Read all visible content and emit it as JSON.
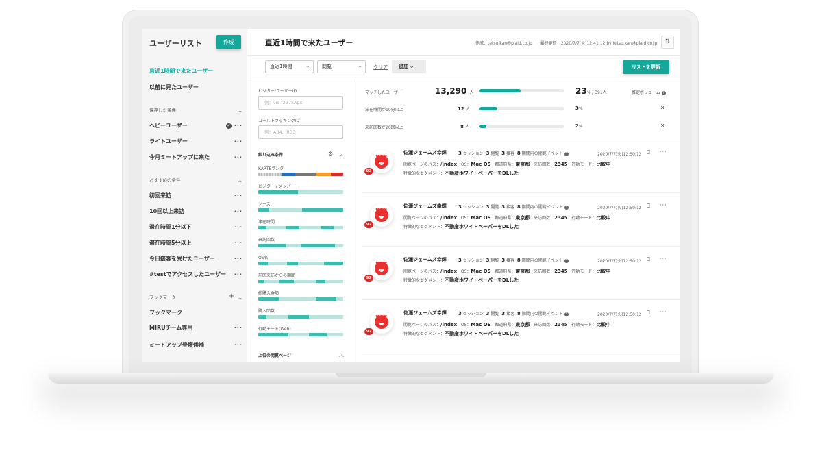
{
  "sidebar": {
    "title": "ユーザーリスト",
    "create_label": "作成",
    "top_items": [
      "直近1時間で来たユーザー",
      "以前に見たユーザー"
    ],
    "saved_section": "保存した条件",
    "saved_items": [
      "ヘビーユーザー",
      "ライトユーザー",
      "今月ミートアップに来た"
    ],
    "recommended_section": "おすすめの条件",
    "recommended_items": [
      "初回来訪",
      "10回以上来訪",
      "滞在時間1分以下",
      "滞在時間5分以上",
      "今日接客を受けたユーザー",
      "#testでアクセスしたユーザー"
    ],
    "bookmark_section": "ブックマーク",
    "bookmark_items": [
      "ブックマーク",
      "MIRUチーム専用",
      "ミートアップ登壇候補"
    ]
  },
  "header": {
    "title": "直近1時間で来たユーザー",
    "meta": "作成：tetsu.kan@plaid.co.jp　　最終更新：2020/7/7(火)12:41:12 by tetsu.kan@plaid.co.jp"
  },
  "toolbar": {
    "period": "直近1時間",
    "type": "閲覧",
    "clear": "クリア",
    "add": "追加",
    "update": "リストを更新"
  },
  "filters": {
    "visitor_id_label": "ビジター/ユーザーID",
    "visitor_id_placeholder": "例：vis-f297kApx",
    "call_id_label": "コールトラッキングID",
    "call_id_placeholder": "例：A34、RB3",
    "narrow_label": "絞り込み条件",
    "bars": [
      "KARTEランク",
      "ビジター / メンバー",
      "ソース",
      "滞在時間",
      "来訪回数",
      "OS名",
      "前回来訪からの期間",
      "総購入金額",
      "購入回数",
      "行動モード(Web)"
    ],
    "top_pages": "上位の閲覧ページ"
  },
  "stats": {
    "matched_label": "マッチしたユーザー",
    "matched_value": "13,290",
    "matched_unit": "人",
    "matched_pct": "23",
    "matched_of": "% / 391人",
    "matched_fill": 0.48,
    "estimate": "推定ボリューム",
    "rows": [
      {
        "label": "滞在時間が10分以上",
        "value": "12",
        "unit": "人",
        "pct": "3",
        "pct_unit": "%",
        "fill": 0.21
      },
      {
        "label": "来訪回数が20回以上",
        "value": "8",
        "unit": "人",
        "pct": "2",
        "pct_unit": "%",
        "fill": 0.08
      }
    ]
  },
  "user_cards": [
    {
      "name": "佐瀬ジェームズ幸輝",
      "sessions": "3",
      "sessions_label": "セッション",
      "views": "3",
      "views_label": "閲覧",
      "contacts": "3",
      "contacts_label": "接客",
      "events": "8",
      "events_label": "期間内の閲覧イベント",
      "date": "2020/7/7(火)12:50:12",
      "path_label": "閲覧ページのパス：",
      "path": "/index",
      "os_label": "OS：",
      "os": "Mac OS",
      "pref_label": "都道府県：",
      "pref": "東京都",
      "visits_label": "来訪回数：",
      "visits": "2345",
      "mode_label": "行動モード：",
      "mode": "比較中",
      "segment_label": "特徴的なセグメント：",
      "segment": "不動産ホワイトペーパーをDLした",
      "score": "92"
    },
    {
      "name": "佐瀬ジェームズ幸輝",
      "sessions": "3",
      "sessions_label": "セッション",
      "views": "3",
      "views_label": "閲覧",
      "contacts": "3",
      "contacts_label": "接客",
      "events": "8",
      "events_label": "期間内の閲覧イベント",
      "date": "2020/7/7(火)12:50:12",
      "path_label": "閲覧ページのパス：",
      "path": "/index",
      "os_label": "OS：",
      "os": "Mac OS",
      "pref_label": "都道府県：",
      "pref": "東京都",
      "visits_label": "来訪回数：",
      "visits": "2345",
      "mode_label": "行動モード：",
      "mode": "比較中",
      "segment_label": "特徴的なセグメント：",
      "segment": "不動産ホワイトペーパーをDLした",
      "score": "92"
    },
    {
      "name": "佐瀬ジェームズ幸輝",
      "sessions": "3",
      "sessions_label": "セッション",
      "views": "3",
      "views_label": "閲覧",
      "contacts": "3",
      "contacts_label": "接客",
      "events": "8",
      "events_label": "期間内の閲覧イベント",
      "date": "2020/7/7(火)12:50:12",
      "path_label": "閲覧ページのパス：",
      "path": "/index",
      "os_label": "OS：",
      "os": "Mac OS",
      "pref_label": "都道府県：",
      "pref": "東京都",
      "visits_label": "来訪回数：",
      "visits": "2345",
      "mode_label": "行動モード：",
      "mode": "比較中",
      "segment_label": "特徴的なセグメント：",
      "segment": "不動産ホワイトペーパーをDLした",
      "score": "92"
    },
    {
      "name": "佐瀬ジェームズ幸輝",
      "sessions": "3",
      "sessions_label": "セッション",
      "views": "3",
      "views_label": "閲覧",
      "contacts": "3",
      "contacts_label": "接客",
      "events": "8",
      "events_label": "期間内の閲覧イベント",
      "date": "2020/7/7(火)12:50:12",
      "path_label": "閲覧ページのパス：",
      "path": "/index",
      "os_label": "OS：",
      "os": "Mac OS",
      "pref_label": "都道府県：",
      "pref": "東京都",
      "visits_label": "来訪回数：",
      "visits": "2345",
      "mode_label": "行動モード：",
      "mode": "比較中",
      "segment_label": "特徴的なセグメント：",
      "segment": "不動産ホワイトペーパーをDLした",
      "score": "92"
    }
  ],
  "colors": {
    "accent": "#15a89a",
    "avatar": "#e8312e",
    "score": "#d62c2a"
  }
}
